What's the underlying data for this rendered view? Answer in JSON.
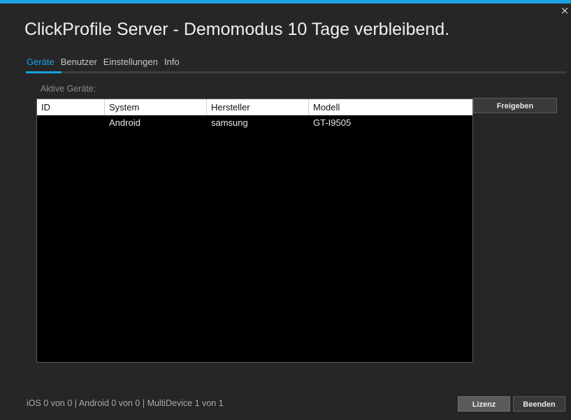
{
  "window": {
    "title": "ClickProfile Server - Demomodus 10 Tage verbleibend.",
    "close_label": "×"
  },
  "tabs": [
    {
      "label": "Geräte",
      "active": true
    },
    {
      "label": "Benutzer",
      "active": false
    },
    {
      "label": "Einstellungen",
      "active": false
    },
    {
      "label": "Info",
      "active": false
    }
  ],
  "devices": {
    "section_label": "Aktive Geräte:",
    "columns": [
      "ID",
      "System",
      "Hersteller",
      "Modell"
    ],
    "rows": [
      {
        "id": "",
        "system": "Android",
        "hersteller": "samsung",
        "modell": "GT-I9505"
      }
    ],
    "release_button": "Freigeben"
  },
  "footer": {
    "status": "iOS 0 von 0 | Android 0 von 0 | MultiDevice 1 von 1",
    "license_button": "Lizenz",
    "exit_button": "Beenden"
  },
  "colors": {
    "accent": "#1ba1e2",
    "background": "#262626",
    "grid_background": "#000000"
  }
}
